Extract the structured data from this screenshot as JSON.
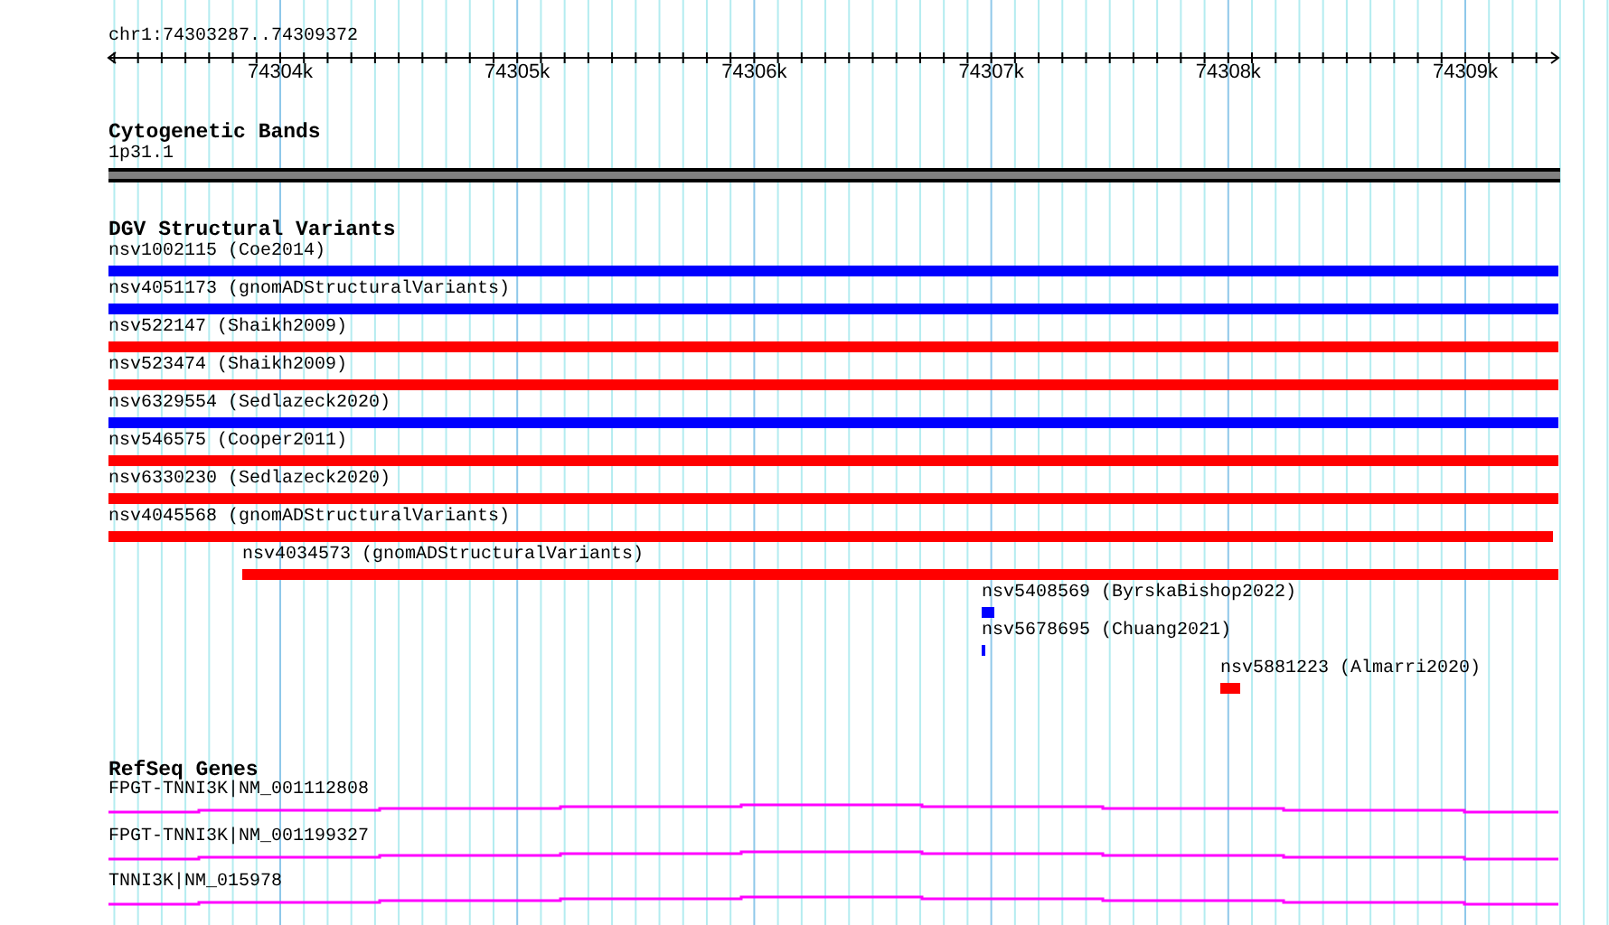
{
  "ruler": {
    "location": "chr1:74303287..74309372",
    "ticks": [
      "74304k",
      "74305k",
      "74306k",
      "74307k",
      "74308k",
      "74309k"
    ]
  },
  "tracks": [
    {
      "title": "Cytogenetic Bands",
      "kind": "bands",
      "features": [
        {
          "label": "1p31.1"
        }
      ]
    },
    {
      "title": "DGV Structural Variants",
      "kind": "variants",
      "features": [
        {
          "label": "nsv1002115 (Coe2014)",
          "color": "#0000ff"
        },
        {
          "label": "nsv4051173 (gnomADStructuralVariants)",
          "color": "#0000ff"
        },
        {
          "label": "nsv522147 (Shaikh2009)",
          "color": "#ff0000"
        },
        {
          "label": "nsv523474 (Shaikh2009)",
          "color": "#ff0000"
        },
        {
          "label": "nsv6329554 (Sedlazeck2020)",
          "color": "#0000ff"
        },
        {
          "label": "nsv546575 (Cooper2011)",
          "color": "#ff0000"
        },
        {
          "label": "nsv6330230 (Sedlazeck2020)",
          "color": "#ff0000"
        },
        {
          "label": "nsv4045568 (gnomADStructuralVariants)",
          "color": "#ff0000"
        },
        {
          "label": "nsv4034573 (gnomADStructuralVariants)",
          "color": "#ff0000"
        },
        {
          "label": "nsv5408569 (ByrskaBishop2022)",
          "color": "#0000ff"
        },
        {
          "label": "nsv5678695 (Chuang2021)",
          "color": "#0000ff"
        },
        {
          "label": "nsv5881223 (Almarri2020)",
          "color": "#ff0000"
        }
      ]
    },
    {
      "title": "RefSeq Genes",
      "kind": "genes",
      "features": [
        {
          "label": "FPGT-TNNI3K|NM_001112808"
        },
        {
          "label": "FPGT-TNNI3K|NM_001199327"
        },
        {
          "label": "TNNI3K|NM_015978"
        }
      ]
    }
  ]
}
